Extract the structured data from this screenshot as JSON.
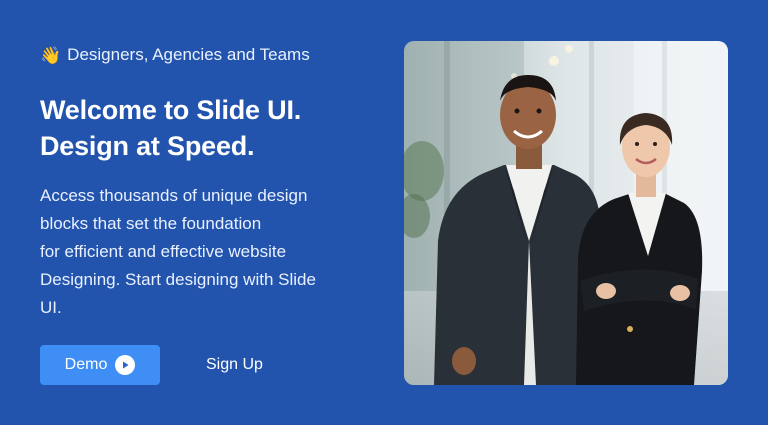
{
  "hero": {
    "eyebrow": {
      "icon": "waving-hand-icon",
      "emoji": "👋",
      "text": "Designers, Agencies and Teams"
    },
    "title_lines": [
      "Welcome to Slide UI.",
      "Design at Speed."
    ],
    "description_lines": [
      "Access thousands of unique design",
      "blocks that set the foundation",
      "for efficient and effective website",
      "Designing. Start designing with Slide",
      "UI."
    ],
    "demo_button": {
      "label": "Demo",
      "icon": "play-circle-icon"
    },
    "signup_link": {
      "label": "Sign Up"
    },
    "image": {
      "subject": "two smiling business professionals in an office"
    }
  },
  "colors": {
    "background": "#2254ad",
    "primary_button": "#3f8ef5",
    "text": "#ffffff"
  }
}
